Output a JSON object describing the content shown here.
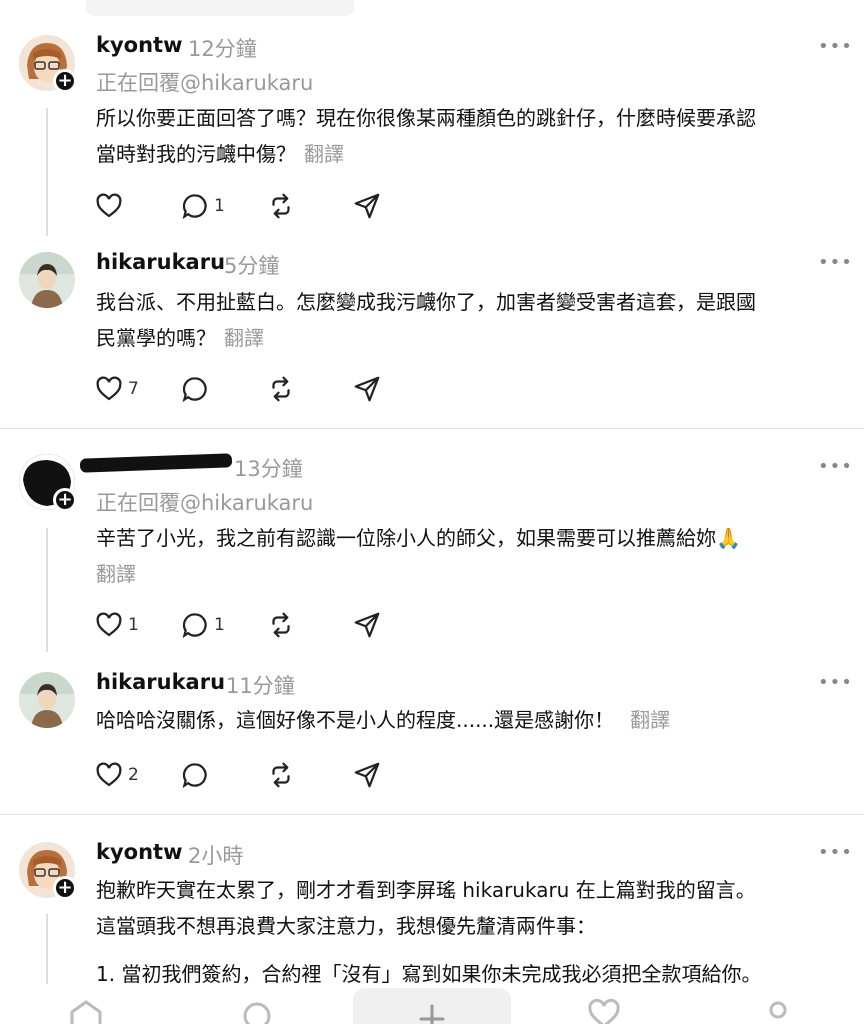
{
  "posts": [
    {
      "username": "kyontw",
      "time": "12分鐘",
      "replying": "正在回覆@hikarukaru",
      "body": "所以你要正面回答了嗎？現在你很像某兩種顏色的跳針仔，什麼時候要承認",
      "body2": "當時對我的污衊中傷？",
      "translate": "翻譯",
      "likes": "",
      "comments": "1"
    },
    {
      "username": "hikarukaru",
      "time": "5分鐘",
      "body": "我台派、不用扯藍白。怎麼變成我污衊你了，加害者變受害者這套，是跟國",
      "body2": "民黨學的嗎？",
      "translate": "翻譯",
      "likes": "7",
      "comments": ""
    },
    {
      "username": "",
      "time": "13分鐘",
      "replying": "正在回覆@hikarukaru",
      "body": "辛苦了小光，我之前有認識一位除小人的師父，如果需要可以推薦給妳🙏",
      "translate": "翻譯",
      "likes": "1",
      "comments": "1"
    },
    {
      "username": "hikarukaru",
      "time": "11分鐘",
      "body": "哈哈哈沒關係，這個好像不是小人的程度......還是感謝你！",
      "translate": "翻譯",
      "likes": "2",
      "comments": ""
    },
    {
      "username": "kyontw",
      "time": "2小時",
      "body": "抱歉昨天實在太累了，剛才才看到李屏瑤 hikarukaru 在上篇對我的留言。",
      "body2": "這當頭我不想再浪費大家注意力，我想優先釐清兩件事：",
      "body3": "1. 當初我們簽約，合約裡「沒有」寫到如果你未完成我必須把全款項給你。"
    }
  ],
  "more_label": "•••",
  "plus_label": "+",
  "icons": [
    "heart-icon",
    "comment-icon",
    "repost-icon",
    "share-icon",
    "home-icon",
    "search-icon",
    "compose-icon",
    "activity-icon",
    "profile-icon"
  ]
}
